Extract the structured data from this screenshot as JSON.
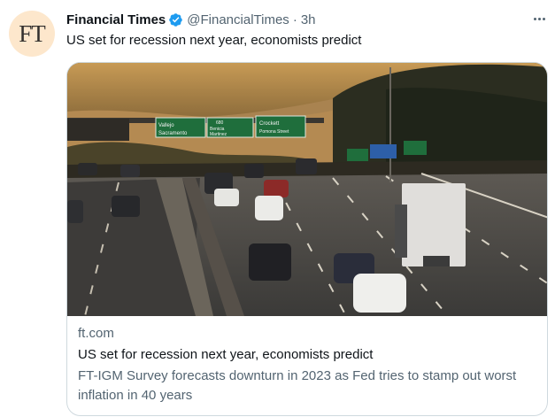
{
  "tweet": {
    "avatar_text": "FT",
    "display_name": "Financial Times",
    "handle": "@FinancialTimes",
    "separator": "·",
    "time": "3h",
    "text": "US set for recession next year, economists predict"
  },
  "card": {
    "domain": "ft.com",
    "title": "US set for recession next year, economists predict",
    "description": "FT-IGM Survey forecasts downturn in 2023 as Fed tries to stamp out worst inflation in 40 years"
  },
  "signs": {
    "left_line1": "Vallejo",
    "left_line2": "Sacramento",
    "mid_top": "680",
    "mid_line1": "Benicia",
    "mid_line2": "Martinez",
    "right_line1": "Crockett",
    "right_line2": "Pomona Street"
  },
  "colors": {
    "accent": "#1d9bf0",
    "avatar_bg": "#fde7cc",
    "text_primary": "#0f1419",
    "text_secondary": "#536471",
    "border": "#cfd9de",
    "sign_green": "#1f6e3c"
  },
  "icons": {
    "verified": "verified-badge-icon",
    "more": "more-options-icon"
  }
}
